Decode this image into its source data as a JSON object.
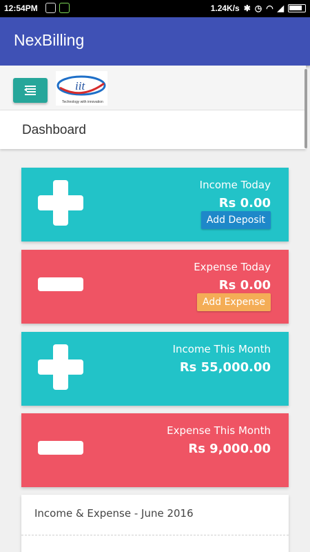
{
  "status_bar": {
    "time": "12:54PM",
    "speed": "1.24K/s",
    "icons": [
      "gallery-icon",
      "android-icon",
      "bluetooth-icon",
      "alarm-icon",
      "wifi-icon",
      "signal-icon",
      "battery-icon"
    ]
  },
  "app": {
    "title": "NexBilling",
    "bar_color": "#3f51b5"
  },
  "toolbar": {
    "menu_icon": "menu-collapse-icon",
    "logo_text": "iit",
    "logo_tagline": "Technology with innovation"
  },
  "page": {
    "title": "Dashboard"
  },
  "cards": [
    {
      "label": "Income Today",
      "amount": "Rs 0.00",
      "action": "Add Deposit",
      "icon": "plus-icon",
      "color": "#22c3c8"
    },
    {
      "label": "Expense Today",
      "amount": "Rs 0.00",
      "action": "Add Expense",
      "icon": "minus-icon",
      "color": "#ef5464"
    },
    {
      "label": "Income This Month",
      "amount": "Rs 55,000.00",
      "icon": "plus-icon",
      "color": "#22c3c8"
    },
    {
      "label": "Expense This Month",
      "amount": "Rs 9,000.00",
      "icon": "minus-icon",
      "color": "#ef5464"
    }
  ],
  "chart_card": {
    "title": "Income & Expense - June 2016"
  }
}
